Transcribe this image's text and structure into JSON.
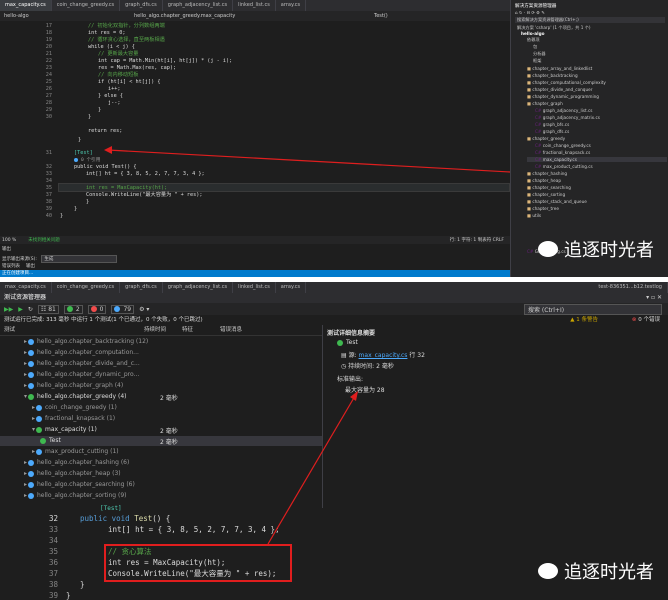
{
  "shot1": {
    "tabs": [
      "max_capacity.cs",
      "coin_change_greedy.cs",
      "graph_dfs.cs",
      "graph_adjacency_list.cs",
      "linked_list.cs",
      "array.cs"
    ],
    "nav": {
      "left": "hello-algo",
      "middle": "hello_algo.chapter_greedy.max_capacity",
      "right": "Test()"
    },
    "lines": [
      {
        "n": "17",
        "t": "// 初始化双指针，分列数组两端"
      },
      {
        "n": "18",
        "t": "int res = 0;"
      },
      {
        "n": "19",
        "t": "// 循环贪心选择，直至两板相遇"
      },
      {
        "n": "20",
        "t": "while (i < j) {"
      },
      {
        "n": "21",
        "t": "// 更新最大容量"
      },
      {
        "n": "22",
        "t": "int cap = Math.Min(ht[i], ht[j]) * (j - i);"
      },
      {
        "n": "23",
        "t": "res = Math.Max(res, cap);"
      },
      {
        "n": "24",
        "t": "// 向内移动短板"
      },
      {
        "n": "25",
        "t": "if (ht[i] < ht[j]) {"
      },
      {
        "n": "26",
        "t": "i++;"
      },
      {
        "n": "27",
        "t": "} else {"
      },
      {
        "n": "28",
        "t": "j--;"
      },
      {
        "n": "29",
        "t": "}"
      },
      {
        "n": "30",
        "t": "}"
      },
      {
        "n": "",
        "t": "return res;"
      },
      {
        "n": "",
        "t": "}"
      },
      {
        "n": "31",
        "t": "[Test]"
      },
      {
        "n": "",
        "t": "0 个引用"
      },
      {
        "n": "32",
        "t": "public void Test() {"
      },
      {
        "n": "33",
        "t": "int[] ht = { 3, 8, 5, 2, 7, 7, 3, 4 };"
      },
      {
        "n": "34",
        "t": ""
      },
      {
        "n": "35",
        "t": "// 贪心算法"
      },
      {
        "n": "36",
        "t": "int res = MaxCapacity(ht);"
      },
      {
        "n": "37",
        "t": "Console.WriteLine(\"最大容量为 \" + res);"
      },
      {
        "n": "38",
        "t": "}"
      },
      {
        "n": "39",
        "t": "}"
      },
      {
        "n": "40",
        "t": ""
      }
    ],
    "status": {
      "zoom": "100 %",
      "issues": "未找到相关问题",
      "pos": "行: 1  字符: 1  制表符  CRLF"
    },
    "output": {
      "title": "输出",
      "source_label": "显示输出来源(S):",
      "source_value": "生成",
      "status_bar": "正在创建项目..."
    },
    "bottom": {
      "tab1": "错误列表",
      "tab2": "输出"
    },
    "solution_explorer": {
      "title": "解决方案资源管理器",
      "search": "搜索解决方案资源管理器(Ctrl+;)",
      "solution": "解决方案 'csharp' (1 个项目，共 1 个)",
      "project": "hello-algo",
      "items": [
        "依赖项",
        "包",
        "分析器",
        "框架",
        "chapter_array_and_linkedlist",
        "chapter_backtracking",
        "chapter_computational_complexity",
        "chapter_divide_and_conquer",
        "chapter_dynamic_programming",
        "chapter_graph",
        "graph_adjacency_list.cs",
        "graph_adjacency_matrix.cs",
        "graph_bfs.cs",
        "graph_dfs.cs",
        "chapter_greedy",
        "coin_change_greedy.cs",
        "fractional_knapsack.cs",
        "max_capacity.cs",
        "max_product_cutting.cs",
        "chapter_hashing",
        "chapter_heap",
        "chapter_searching",
        "chapter_sorting",
        "chapter_stack_and_queue",
        "chapter_tree",
        "utils",
        "GlobalUsing.cs"
      ]
    }
  },
  "shot2": {
    "tabs": [
      "max_capacity.cs",
      "coin_change_greedy.cs",
      "graph_dfs.cs",
      "graph_adjacency_list.cs",
      "linked_list.cs",
      "array.cs",
      "test-836351...b12.testlog"
    ],
    "panel_title": "测试资源管理器",
    "toolbar": {
      "total": "81",
      "passed": "2",
      "failed": "0",
      "skipped": "79"
    },
    "search_placeholder": "搜索 (Ctrl+I)",
    "summary": "测试运行已完成: 313 毫秒 中运行 1 个测试(1 个已通过，0 个失败，0 个已跳过)",
    "warnings": "1 条警告",
    "errors": "0 个错误",
    "columns": {
      "test": "测试",
      "duration": "持续时间",
      "trait": "特征",
      "error": "错误消息"
    },
    "tree": [
      {
        "label": "hello_algo.chapter_backtracking (12)",
        "d": ""
      },
      {
        "label": "hello_algo.chapter_computation...",
        "d": ""
      },
      {
        "label": "hello_algo.chapter_divide_and_c...",
        "d": ""
      },
      {
        "label": "hello_algo.chapter_dynamic_pro...",
        "d": ""
      },
      {
        "label": "hello_algo.chapter_graph (4)",
        "d": ""
      },
      {
        "label": "hello_algo.chapter_greedy (4)",
        "d": "2 毫秒"
      },
      {
        "label": "coin_change_greedy (1)",
        "d": ""
      },
      {
        "label": "fractional_knapsack (1)",
        "d": ""
      },
      {
        "label": "max_capacity (1)",
        "d": "2 毫秒"
      },
      {
        "label": "Test",
        "d": "2 毫秒"
      },
      {
        "label": "max_product_cutting (1)",
        "d": ""
      },
      {
        "label": "hello_algo.chapter_hashing (6)",
        "d": ""
      },
      {
        "label": "hello_algo.chapter_heap (3)",
        "d": ""
      },
      {
        "label": "hello_algo.chapter_searching (6)",
        "d": ""
      },
      {
        "label": "hello_algo.chapter_sorting (9)",
        "d": ""
      }
    ],
    "detail": {
      "title": "测试详细信息摘要",
      "test": "Test",
      "source_label": "源:",
      "source_link": "max_capacity.cs",
      "source_line": "行 32",
      "duration": "持续时间: 2 毫秒",
      "stdout_label": "标准输出:",
      "stdout": "最大容量为 28"
    },
    "code": [
      {
        "n": "",
        "t": "[Test]"
      },
      {
        "n": "32",
        "t": "public void Test() {"
      },
      {
        "n": "33",
        "t": "int[] ht = { 3, 8, 5, 2, 7, 7, 3, 4 };"
      },
      {
        "n": "34",
        "t": ""
      },
      {
        "n": "35",
        "t": "// 贪心算法"
      },
      {
        "n": "36",
        "t": "int res = MaxCapacity(ht);"
      },
      {
        "n": "37",
        "t": "Console.WriteLine(\"最大容量为 \" + res);"
      },
      {
        "n": "38",
        "t": "}"
      },
      {
        "n": "39",
        "t": "}"
      }
    ]
  },
  "watermark": "追逐时光者",
  "colors": {
    "accent": "#007acc",
    "pass": "#3fb950",
    "fail": "#f14c4c",
    "highlight_box": "#e01e1e",
    "link": "#4daafc"
  }
}
